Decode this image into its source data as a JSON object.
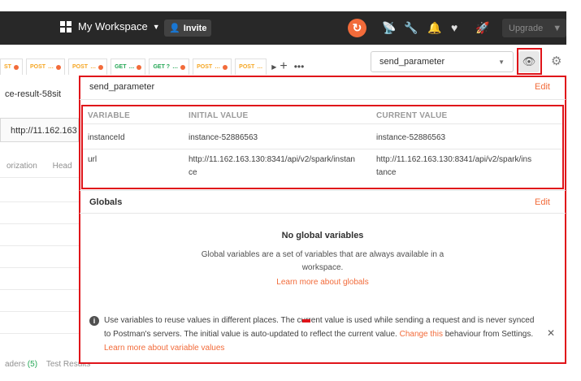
{
  "topbar": {
    "workspace_label": "My Workspace",
    "invite_label": "Invite",
    "upgrade_label": "Upgrade",
    "icons": [
      "grid-icon",
      "sync-icon",
      "satellite-icon",
      "wrench-icon",
      "bell-icon",
      "heart-icon",
      "rocket-icon"
    ]
  },
  "tabs": [
    {
      "method": "ST",
      "method_color": "#f5a623"
    },
    {
      "method": "POST",
      "method_color": "#f5a623"
    },
    {
      "method": "POST",
      "method_color": "#f5a623"
    },
    {
      "method": "GET",
      "method_color": "#23a755"
    },
    {
      "method": "GET ?",
      "method_color": "#23a755"
    },
    {
      "method": "POST",
      "method_color": "#f5a623"
    },
    {
      "method": "POST",
      "method_color": "#f5a623"
    }
  ],
  "environment": {
    "selected": "send_parameter"
  },
  "left_panel": {
    "request_title": "ce-result-58sit",
    "url_value": "http://11.162.163",
    "subtab_auth": "orization",
    "subtab_head": "Head",
    "bottom_headers": "aders (5)",
    "bottom_headers_prefix": "aders ",
    "bottom_headers_count": "(5)",
    "bottom_tests": "Test Results"
  },
  "popover": {
    "env_name": "send_parameter",
    "edit_label": "Edit",
    "columns": {
      "variable": "VARIABLE",
      "initial": "INITIAL VALUE",
      "current": "CURRENT VALUE"
    },
    "rows": [
      {
        "variable": "instanceId",
        "initial": "instance-52886563",
        "current": "instance-52886563"
      },
      {
        "variable": "url",
        "initial_l1": "http://11.162.163.130:8341/api/v2/spark/instan",
        "initial_l2": "ce",
        "current_l1": "http://11.162.163.130:8341/api/v2/spark/ins",
        "current_l2": "tance"
      }
    ],
    "globals_title": "Globals",
    "globals_edit": "Edit",
    "no_globals": "No global variables",
    "globals_desc": "Global variables are a set of variables that are always available in a workspace.",
    "globals_link": "Learn more about globals",
    "info_part1": "Use variables to reuse values in different places. The current value is used while sending a request and is never synced to Postman's servers. The initial value is auto-updated to reflect the current value.",
    "info_link1": "Change this",
    "info_part2": "behaviour from Settings.",
    "info_link2": "Learn more about variable values"
  },
  "colors": {
    "accent": "#f26b3a",
    "highlight_outline": "#e0141a",
    "topbar_bg": "#282828"
  }
}
